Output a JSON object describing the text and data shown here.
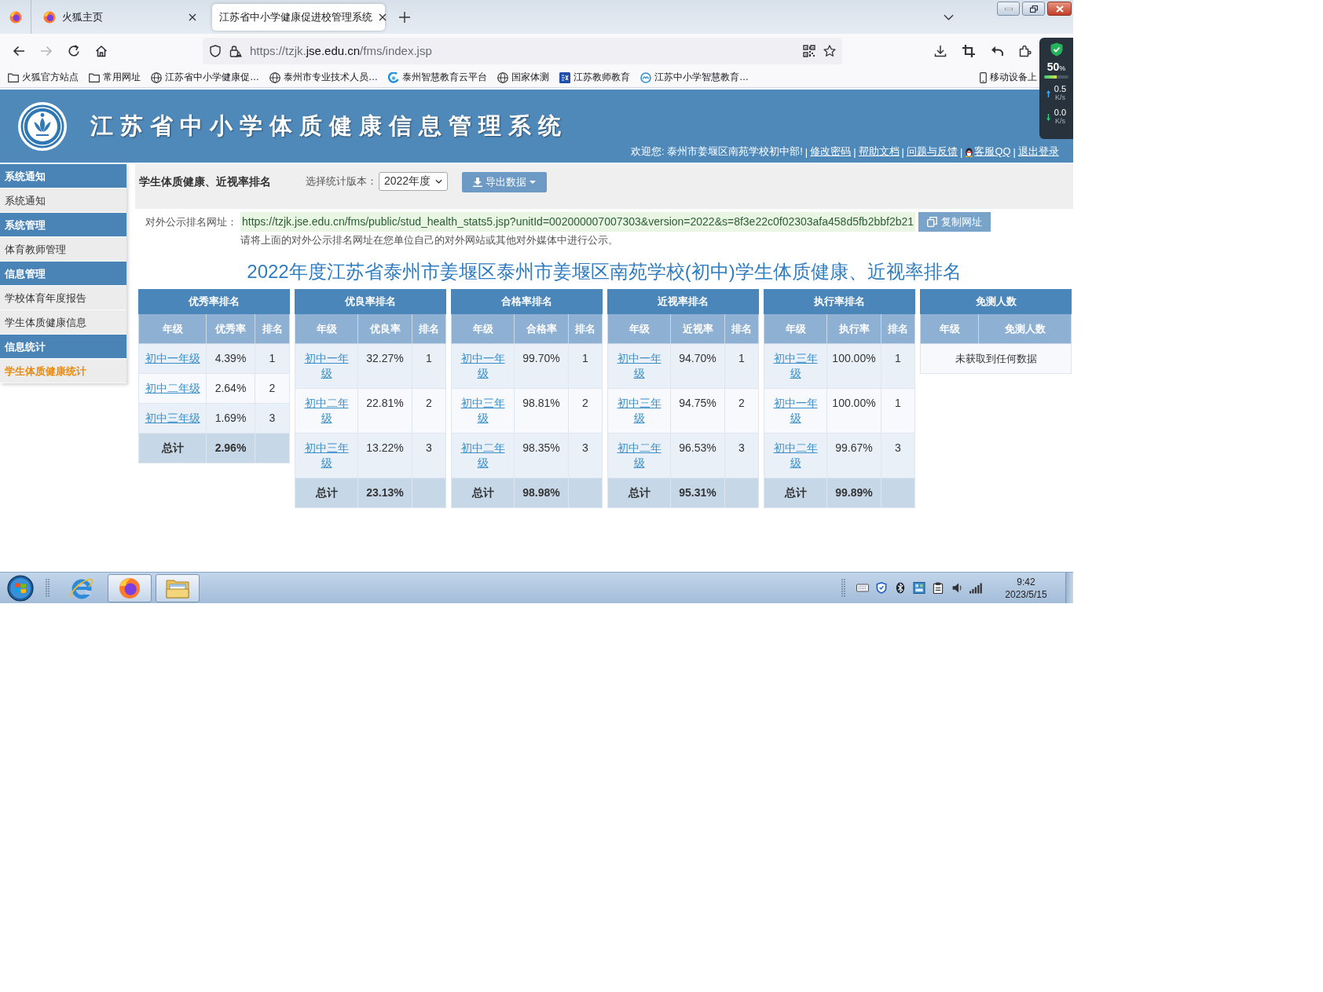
{
  "browser": {
    "tabs": [
      {
        "title": "火狐主页",
        "has_icon": true,
        "selected": false
      },
      {
        "title": "江苏省中小学健康促进校管理系统",
        "has_icon": false,
        "selected": true
      }
    ],
    "navigation": {
      "back_disabled": false,
      "forward_disabled": true
    },
    "address_bar": {
      "url_start": "https://tzjk.",
      "url_domain": "jse.edu.cn",
      "url_end": "/fms/index.jsp"
    },
    "bookmarks": [
      {
        "kind": "folder",
        "label": "火狐官方站点"
      },
      {
        "kind": "folder",
        "label": "常用网址"
      },
      {
        "kind": "globe",
        "label": "江苏省中小学健康促…"
      },
      {
        "kind": "globe",
        "label": "泰州市专业技术人员…"
      },
      {
        "kind": "swirl",
        "label": "泰州智慧教育云平台"
      },
      {
        "kind": "globe",
        "label": "国家体测"
      },
      {
        "kind": "tile",
        "label": "江苏教师教育"
      },
      {
        "kind": "ring",
        "label": "江苏中小学智慧教育…"
      }
    ],
    "mobile_bookmarks": "移动设备上"
  },
  "monitor_widget": {
    "value": "50",
    "unit": "%",
    "level": 0.5,
    "upload": {
      "value": "0.5",
      "unit": "K/s"
    },
    "download": {
      "value": "0.0",
      "unit": "K/s"
    }
  },
  "header": {
    "title": "江苏省中小学体质健康信息管理系统",
    "user_bar": [
      {
        "kind": "text",
        "text": "欢迎您: 泰州市姜堰区南苑学校初中部!"
      },
      {
        "kind": "separator",
        "text": "|"
      },
      {
        "kind": "link",
        "text": "修改密码"
      },
      {
        "kind": "separator",
        "text": "|"
      },
      {
        "kind": "link",
        "text": "帮助文档"
      },
      {
        "kind": "separator",
        "text": "|"
      },
      {
        "kind": "link",
        "text": "问题与反馈"
      },
      {
        "kind": "separator",
        "text": "|"
      },
      {
        "kind": "qq_link",
        "text": "客服QQ"
      },
      {
        "kind": "separator",
        "text": "|"
      },
      {
        "kind": "link",
        "text": "退出登录"
      }
    ]
  },
  "sidebar": {
    "groups": [
      {
        "title": "系统通知",
        "items": [
          {
            "label": "系统通知",
            "selected": false
          }
        ]
      },
      {
        "title": "系统管理",
        "items": [
          {
            "label": "体育教师管理",
            "selected": false
          }
        ]
      },
      {
        "title": "信息管理",
        "items": [
          {
            "label": "学校体育年度报告",
            "selected": false
          },
          {
            "label": "学生体质健康信息",
            "selected": false
          }
        ]
      },
      {
        "title": "信息统计",
        "items": [
          {
            "label": "学生体质健康统计",
            "selected": true
          }
        ]
      }
    ]
  },
  "toolbar": {
    "page_title": "学生体质健康、近视率排名",
    "version_label": "选择统计版本：",
    "version_select": {
      "value": "2022年度"
    },
    "export_button": "导出数据"
  },
  "public_url": {
    "label": "对外公示排名网址：",
    "url": "https://tzjk.jse.edu.cn/fms/public/stud_health_stats5.jsp?unitId=002000007007303&version=2022&s=8f3e22c0f02303afa458d5fb2bbf2b21",
    "copy_button": "复制网址",
    "note": "请将上面的对外公示排名网址在您单位自己的对外网站或其他对外媒体中进行公示。"
  },
  "report": {
    "title": "2022年度江苏省泰州市姜堰区泰州市姜堰区南苑学校(初中)学生体质健康、近视率排名",
    "tables": [
      {
        "title": "优秀率排名",
        "columns": [
          "年级",
          "优秀率",
          "排名"
        ],
        "rows": [
          [
            "初中一年级",
            "4.39%",
            "1"
          ],
          [
            "初中二年级",
            "2.64%",
            "2"
          ],
          [
            "初中三年级",
            "1.69%",
            "3"
          ]
        ],
        "total": {
          "label": "总计",
          "value": "2.96%"
        }
      },
      {
        "title": "优良率排名",
        "columns": [
          "年级",
          "优良率",
          "排名"
        ],
        "rows": [
          [
            "初中一年级",
            "32.27%",
            "1"
          ],
          [
            "初中二年级",
            "22.81%",
            "2"
          ],
          [
            "初中三年级",
            "13.22%",
            "3"
          ]
        ],
        "total": {
          "label": "总计",
          "value": "23.13%"
        }
      },
      {
        "title": "合格率排名",
        "columns": [
          "年级",
          "合格率",
          "排名"
        ],
        "rows": [
          [
            "初中一年级",
            "99.70%",
            "1"
          ],
          [
            "初中三年级",
            "98.81%",
            "2"
          ],
          [
            "初中二年级",
            "98.35%",
            "3"
          ]
        ],
        "total": {
          "label": "总计",
          "value": "98.98%"
        }
      },
      {
        "title": "近视率排名",
        "columns": [
          "年级",
          "近视率",
          "排名"
        ],
        "rows": [
          [
            "初中一年级",
            "94.70%",
            "1"
          ],
          [
            "初中三年级",
            "94.75%",
            "2"
          ],
          [
            "初中二年级",
            "96.53%",
            "3"
          ]
        ],
        "total": {
          "label": "总计",
          "value": "95.31%"
        }
      },
      {
        "title": "执行率排名",
        "columns": [
          "年级",
          "执行率",
          "排名"
        ],
        "rows": [
          [
            "初中三年级",
            "100.00%",
            "1"
          ],
          [
            "初中一年级",
            "100.00%",
            "1"
          ],
          [
            "初中二年级",
            "99.67%",
            "3"
          ]
        ],
        "total": {
          "label": "总计",
          "value": "99.89%"
        }
      },
      {
        "title": "免测人数",
        "columns": [
          "年级",
          "免测人数"
        ],
        "empty_message": "未获取到任何数据"
      }
    ]
  },
  "taskbar": {
    "apps": [
      {
        "kind": "ie",
        "running": false
      },
      {
        "kind": "firefox",
        "running": true
      },
      {
        "kind": "explorer",
        "running": true
      }
    ],
    "time": "9:42",
    "date": "2023/5/15"
  }
}
